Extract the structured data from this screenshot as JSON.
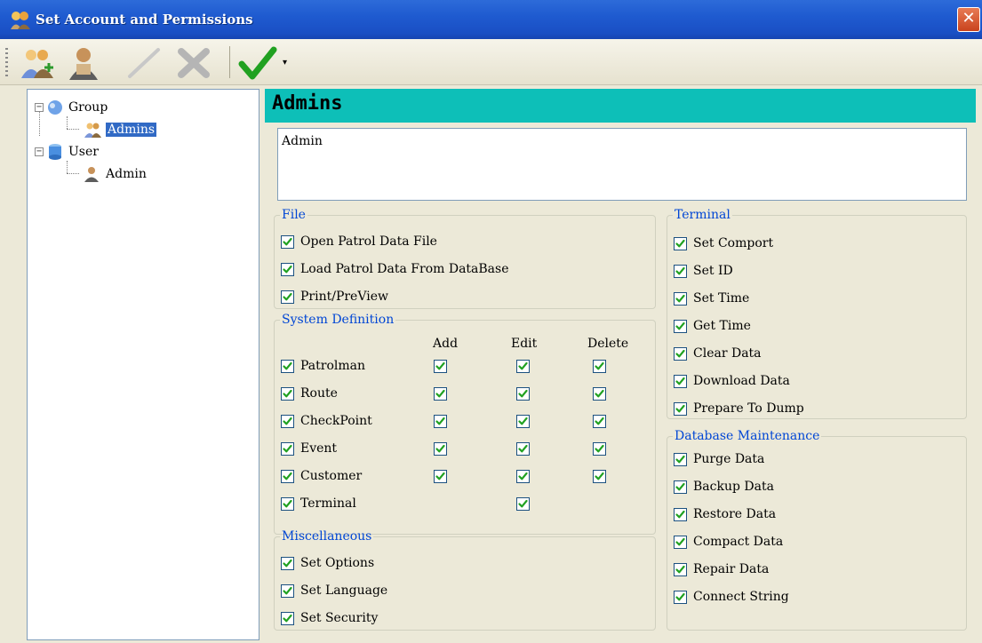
{
  "window": {
    "title": "Set Account and Permissions",
    "close_glyph": "✕"
  },
  "toolbar": {
    "buttons": [
      {
        "name": "add-group-icon"
      },
      {
        "name": "add-user-icon"
      },
      {
        "name": "edit-icon"
      },
      {
        "name": "delete-icon"
      },
      {
        "name": "apply-check-icon"
      }
    ],
    "dropdown_glyph": "▾"
  },
  "tree": {
    "group_label": "Group",
    "group_child": "Admins",
    "user_label": "User",
    "user_child": "Admin",
    "collapse_glyph": "−"
  },
  "detail": {
    "heading": "Admins",
    "description": "Admin"
  },
  "file": {
    "legend": "File",
    "items": [
      "Open Patrol Data File",
      "Load Patrol Data From DataBase",
      "Print/PreView"
    ]
  },
  "sysdef": {
    "legend": "System Definition",
    "col_add": "Add",
    "col_edit": "Edit",
    "col_delete": "Delete",
    "rows": [
      {
        "label": "Patrolman",
        "add": true,
        "edit": true,
        "delete": true
      },
      {
        "label": "Route",
        "add": true,
        "edit": true,
        "delete": true
      },
      {
        "label": "CheckPoint",
        "add": true,
        "edit": true,
        "delete": true
      },
      {
        "label": "Event",
        "add": true,
        "edit": true,
        "delete": true
      },
      {
        "label": "Customer",
        "add": true,
        "edit": true,
        "delete": true
      },
      {
        "label": "Terminal",
        "add": false,
        "edit": true,
        "delete": false
      }
    ]
  },
  "misc": {
    "legend": "Miscellaneous",
    "items": [
      "Set Options",
      "Set Language",
      "Set Security"
    ]
  },
  "terminal": {
    "legend": "Terminal",
    "items": [
      "Set Comport",
      "Set ID",
      "Set Time",
      "Get Time",
      "Clear Data",
      "Download Data",
      "Prepare To Dump"
    ]
  },
  "dbmaint": {
    "legend": "Database Maintenance",
    "items": [
      "Purge Data",
      "Backup Data",
      "Restore Data",
      "Compact Data",
      "Repair Data",
      "Connect String"
    ]
  },
  "colors": {
    "accent_header": "#0dbfb8",
    "legend_blue": "#0046d5",
    "check_green": "#21a121",
    "selection": "#316ac5"
  }
}
